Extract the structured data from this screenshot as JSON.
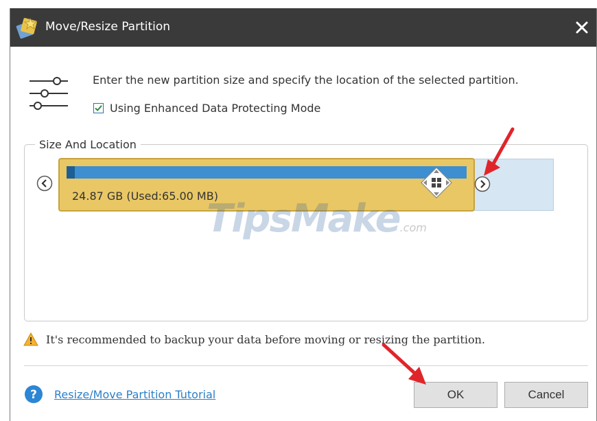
{
  "window": {
    "title": "Move/Resize Partition"
  },
  "header": {
    "instruction": "Enter the new partition size and specify the location of the selected partition.",
    "enhanced_mode": {
      "label": "Using Enhanced Data Protecting Mode",
      "checked": true
    }
  },
  "size_location": {
    "group_label": "Size And Location",
    "partition_label": "24.87 GB (Used:65.00 MB)",
    "used_fraction": 0.003
  },
  "watermark": {
    "text": "TipsMake",
    "suffix": ".com"
  },
  "warning": {
    "text": "It's recommended to backup your data before moving or resizing the partition."
  },
  "footer": {
    "tutorial_link": "Resize/Move Partition Tutorial",
    "ok_label": "OK",
    "cancel_label": "Cancel"
  },
  "colors": {
    "titlebar": "#3a3a3a",
    "partition_fill": "#e9c765",
    "usage_bar": "#3d8fd1",
    "free_space": "#d6e6f2",
    "link": "#2c7fc8",
    "annotation_arrow": "#e0252a",
    "warning_icon": "#f2b233"
  },
  "icons": [
    "app-partition-icon",
    "close-icon",
    "settings-sliders-icon",
    "check-icon",
    "chevron-left-icon",
    "chevron-right-icon",
    "move-handle-icon",
    "warning-icon",
    "help-icon"
  ]
}
